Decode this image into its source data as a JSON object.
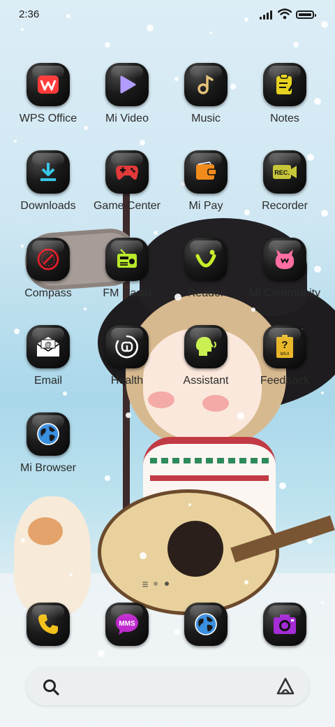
{
  "status_bar": {
    "time": "2:36"
  },
  "apps": [
    {
      "label": "WPS Office",
      "icon": "wps-office-icon",
      "color": "#ff3b3b"
    },
    {
      "label": "Mi Video",
      "icon": "play-icon",
      "color": "#b19cff"
    },
    {
      "label": "Music",
      "icon": "music-note-icon",
      "color": "#e6c27a"
    },
    {
      "label": "Notes",
      "icon": "notes-icon",
      "color": "#e6d21f"
    },
    {
      "label": "Downloads",
      "icon": "download-icon",
      "color": "#39c6e8"
    },
    {
      "label": "Game Center",
      "icon": "gamepad-icon",
      "color": "#e23a3a"
    },
    {
      "label": "Mi Pay",
      "icon": "wallet-icon",
      "color": "#f28a1c"
    },
    {
      "label": "Recorder",
      "icon": "rec-camera-icon",
      "color": "#c7c63a"
    },
    {
      "label": "Compass",
      "icon": "compass-icon",
      "color": "#e01f2a"
    },
    {
      "label": "FM Radio",
      "icon": "radio-icon",
      "color": "#b8ea2a"
    },
    {
      "label": "Reader",
      "icon": "smile-icon",
      "color": "#c8f02a"
    },
    {
      "label": "Mi Community",
      "icon": "mi-bunny-icon",
      "color": "#ff6fa3"
    },
    {
      "label": "Email",
      "icon": "email-icon",
      "color": "#ffffff"
    },
    {
      "label": "Health",
      "icon": "mi-health-icon",
      "color": "#ffffff"
    },
    {
      "label": "Assistant",
      "icon": "assistant-head-icon",
      "color": "#c9f050"
    },
    {
      "label": "Feedback",
      "icon": "feedback-question-icon",
      "color": "#e8b82a"
    },
    {
      "label": "Mi Browser",
      "icon": "globe-icon",
      "color": "#3a8fe0"
    }
  ],
  "dock": [
    {
      "name": "phone",
      "icon": "phone-icon",
      "color": "#f2c11c"
    },
    {
      "name": "messages",
      "icon": "mms-icon",
      "text": "MMS",
      "color": "#c02bd0"
    },
    {
      "name": "browser",
      "icon": "globe-icon",
      "color": "#3a8fe0"
    },
    {
      "name": "camera",
      "icon": "camera-icon",
      "color": "#a52cd6"
    }
  ],
  "search": {
    "icon": "search-icon",
    "assistant_icon": "assistant-triangle-icon"
  },
  "pager": {
    "pages": 2,
    "current": 2
  },
  "feedback_badge": "MIUI",
  "recorder_text": "REC."
}
